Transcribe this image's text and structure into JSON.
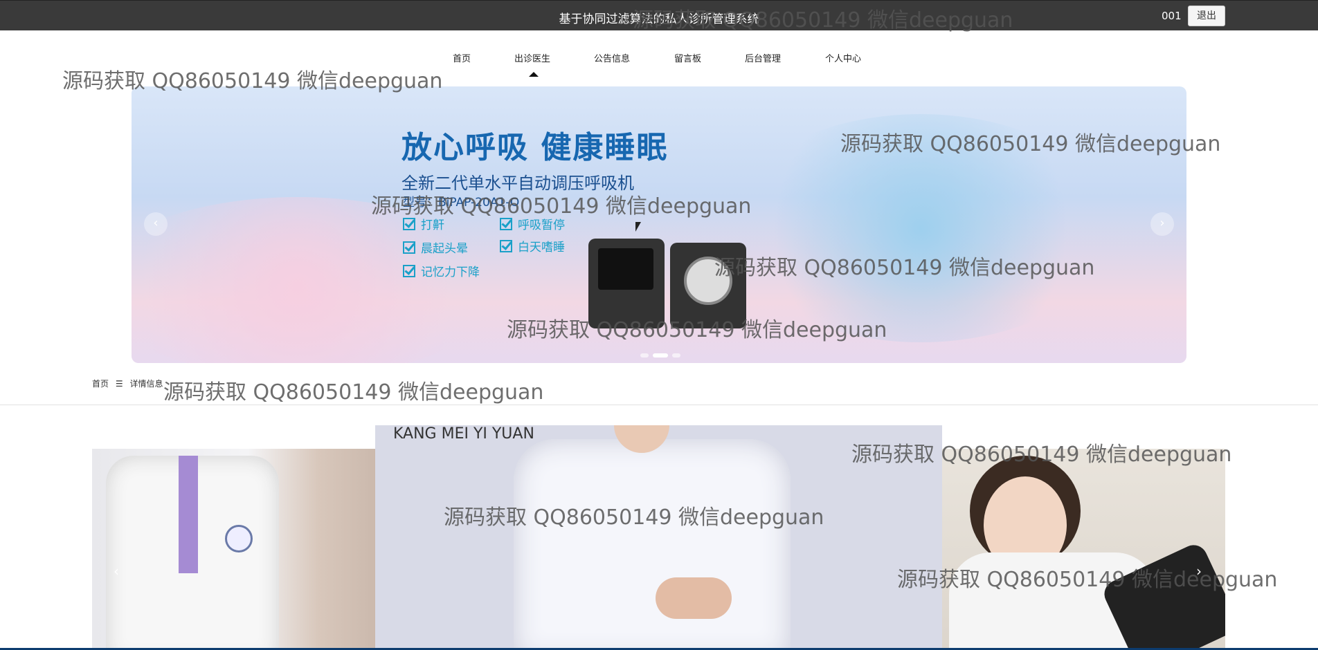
{
  "header": {
    "title": "基于协同过滤算法的私人诊所管理系统",
    "username": "001",
    "logout_label": "退出"
  },
  "nav": {
    "items": [
      {
        "label": "首页"
      },
      {
        "label": "出诊医生"
      },
      {
        "label": "公告信息"
      },
      {
        "label": "留言板"
      },
      {
        "label": "后台管理"
      },
      {
        "label": "个人中心"
      }
    ],
    "active_index": 1
  },
  "banner": {
    "headline": "放心呼吸 健康睡眠",
    "subline": "全新二代单水平自动调压呼吸机",
    "model": "型号：BiPAP-20A1-O",
    "features": [
      "打鼾",
      "呼吸暂停",
      "晨起头晕",
      "白天嗜睡",
      "记忆力下降"
    ],
    "prev_icon": "‹",
    "next_icon": "›",
    "dot_count": 3,
    "active_dot": 1
  },
  "breadcrumb": {
    "home": "首页",
    "separator": "☰",
    "current": "详情信息"
  },
  "gallery": {
    "center_caption": "KANG MEI YI YUAN",
    "prev_icon": "‹",
    "next_icon": "›"
  },
  "watermark": {
    "text": "源码获取 QQ86050149 微信deepguan"
  },
  "colors": {
    "topbar": "#3a3a3a",
    "headline": "#1767b0",
    "feature": "#1aa0c8",
    "footer_line": "#0c3b6e"
  }
}
